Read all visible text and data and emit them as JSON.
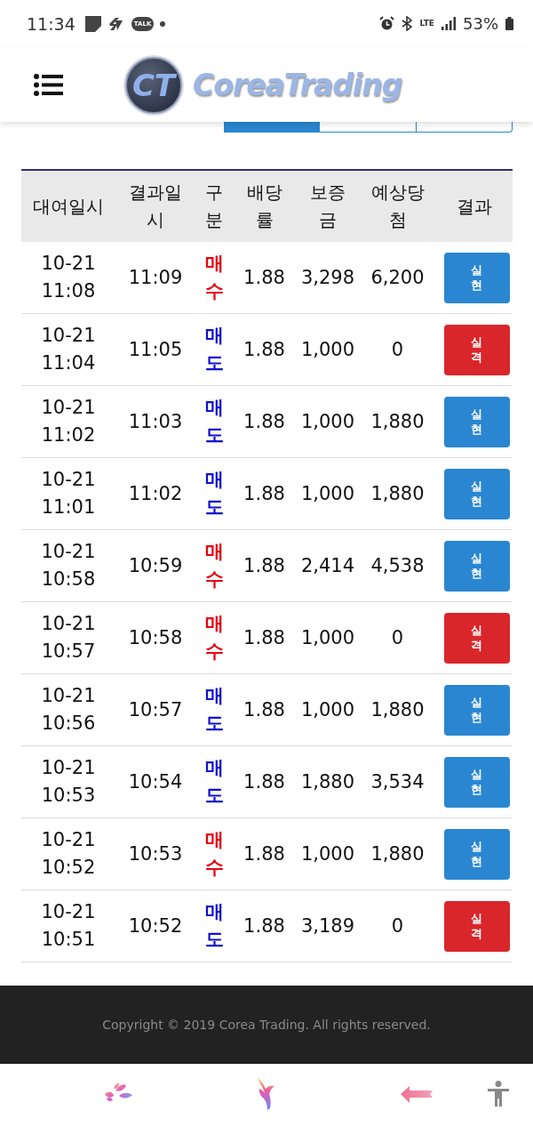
{
  "status_bar": {
    "time": "11:34",
    "chat_badge": "TALK",
    "network": "LTE",
    "battery": "53%"
  },
  "header": {
    "logo_mark": "CT",
    "logo_text": "CoreaTrading"
  },
  "tabs": [
    {
      "selected": true
    },
    {
      "selected": false
    },
    {
      "selected": false
    }
  ],
  "table": {
    "columns": [
      "대여일시",
      "결과일시",
      "구분",
      "배당률",
      "보증금",
      "예상당첨",
      "결과"
    ],
    "rows": [
      {
        "rent_time": "10-21 11:08",
        "result_time": "11:09",
        "side": {
          "text": "매수",
          "color": "#e60012"
        },
        "rate": "1.88",
        "deposit": "3,298",
        "expected": "6,200",
        "result": {
          "text": "실현",
          "color": "#2a86d1"
        }
      },
      {
        "rent_time": "10-21 11:04",
        "result_time": "11:05",
        "side": {
          "text": "매도",
          "color": "#1010d0"
        },
        "rate": "1.88",
        "deposit": "1,000",
        "expected": "0",
        "result": {
          "text": "실격",
          "color": "#d9262b"
        }
      },
      {
        "rent_time": "10-21 11:02",
        "result_time": "11:03",
        "side": {
          "text": "매도",
          "color": "#1010d0"
        },
        "rate": "1.88",
        "deposit": "1,000",
        "expected": "1,880",
        "result": {
          "text": "실현",
          "color": "#2a86d1"
        }
      },
      {
        "rent_time": "10-21 11:01",
        "result_time": "11:02",
        "side": {
          "text": "매도",
          "color": "#1010d0"
        },
        "rate": "1.88",
        "deposit": "1,000",
        "expected": "1,880",
        "result": {
          "text": "실현",
          "color": "#2a86d1"
        }
      },
      {
        "rent_time": "10-21 10:58",
        "result_time": "10:59",
        "side": {
          "text": "매수",
          "color": "#e60012"
        },
        "rate": "1.88",
        "deposit": "2,414",
        "expected": "4,538",
        "result": {
          "text": "실현",
          "color": "#2a86d1"
        }
      },
      {
        "rent_time": "10-21 10:57",
        "result_time": "10:58",
        "side": {
          "text": "매수",
          "color": "#e60012"
        },
        "rate": "1.88",
        "deposit": "1,000",
        "expected": "0",
        "result": {
          "text": "실격",
          "color": "#d9262b"
        }
      },
      {
        "rent_time": "10-21 10:56",
        "result_time": "10:57",
        "side": {
          "text": "매도",
          "color": "#1010d0"
        },
        "rate": "1.88",
        "deposit": "1,000",
        "expected": "1,880",
        "result": {
          "text": "실현",
          "color": "#2a86d1"
        }
      },
      {
        "rent_time": "10-21 10:53",
        "result_time": "10:54",
        "side": {
          "text": "매도",
          "color": "#1010d0"
        },
        "rate": "1.88",
        "deposit": "1,880",
        "expected": "3,534",
        "result": {
          "text": "실현",
          "color": "#2a86d1"
        }
      },
      {
        "rent_time": "10-21 10:52",
        "result_time": "10:53",
        "side": {
          "text": "매수",
          "color": "#e60012"
        },
        "rate": "1.88",
        "deposit": "1,000",
        "expected": "1,880",
        "result": {
          "text": "실현",
          "color": "#2a86d1"
        }
      },
      {
        "rent_time": "10-21 10:51",
        "result_time": "10:52",
        "side": {
          "text": "매도",
          "color": "#1010d0"
        },
        "rate": "1.88",
        "deposit": "3,189",
        "expected": "0",
        "result": {
          "text": "실격",
          "color": "#d9262b"
        }
      }
    ]
  },
  "footer": {
    "copyright": "Copyright © 2019 Corea Trading. All rights reserved."
  }
}
